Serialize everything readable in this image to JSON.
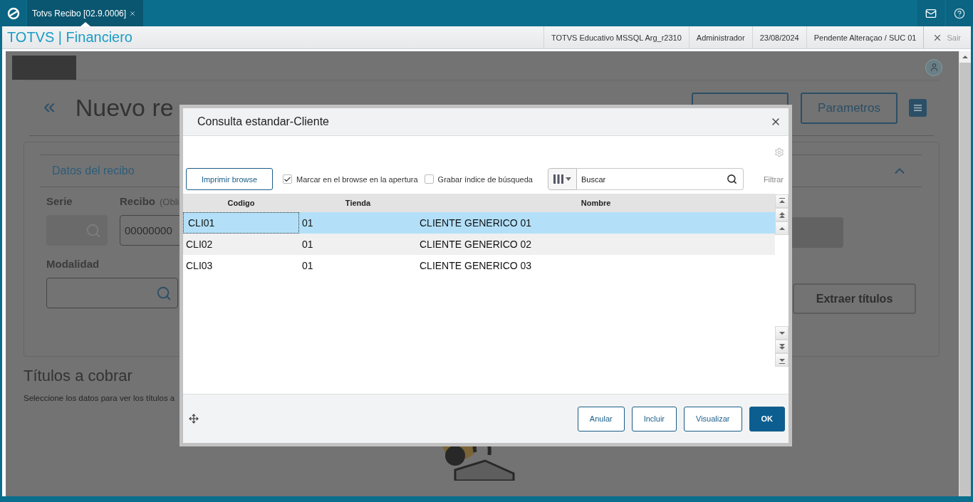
{
  "app_tab": {
    "title": "Totvs Recibo [02.9.0006]",
    "selected": true
  },
  "header": {
    "title": "TOTVS | Financiero",
    "info": [
      "TOTVS Educativo MSSQL Arg_r2310",
      "Administrador",
      "23/08/2024",
      "Pendente Alteraçao / SUC 01"
    ],
    "exit": "Sair"
  },
  "page": {
    "back": "«",
    "title": "Nuevo re",
    "buttons": [
      "Parametros"
    ],
    "section": {
      "title": "Datos del recibo",
      "expanded": true
    },
    "fields": [
      {
        "label": "Serie",
        "kind": "lookup",
        "disabled": true
      },
      {
        "label": "Recibo",
        "note": "(Obli",
        "kind": "text",
        "value": "00000000",
        "disabled": false
      },
      {
        "label": "Modalidad",
        "kind": "lookup",
        "disabled": false
      }
    ],
    "extract_button": "Extraer títulos",
    "results_title": "Títulos a cobrar",
    "results_hint": "Seleccione los datos para ver los títulos a"
  },
  "dialog": {
    "title": "Consulta estandar-Cliente",
    "print_button": "Imprimir browse",
    "options": [
      {
        "label": "Marcar en el browse en la apertura",
        "checked": true
      },
      {
        "label": "Grabar índice de búsqueda",
        "checked": false
      }
    ],
    "search": {
      "placeholder": "Buscar"
    },
    "filter": "Filtrar",
    "columns": [
      "Codigo",
      "Tienda",
      "Nombre"
    ],
    "rows": [
      {
        "cells": [
          "CLI01",
          "01",
          "CLIENTE GENERICO 01"
        ],
        "selected": true
      },
      {
        "cells": [
          "CLI02",
          "01",
          "CLIENTE GENERICO 02"
        ],
        "selected": false
      },
      {
        "cells": [
          "CLI03",
          "01",
          "CLIENTE GENERICO 03"
        ],
        "selected": false
      }
    ],
    "buttons": [
      {
        "label": "Anular",
        "kind": "outline"
      },
      {
        "label": "Incluir",
        "kind": "outline"
      },
      {
        "label": "Visualizar",
        "kind": "outline"
      },
      {
        "label": "OK",
        "kind": "primary"
      }
    ]
  }
}
